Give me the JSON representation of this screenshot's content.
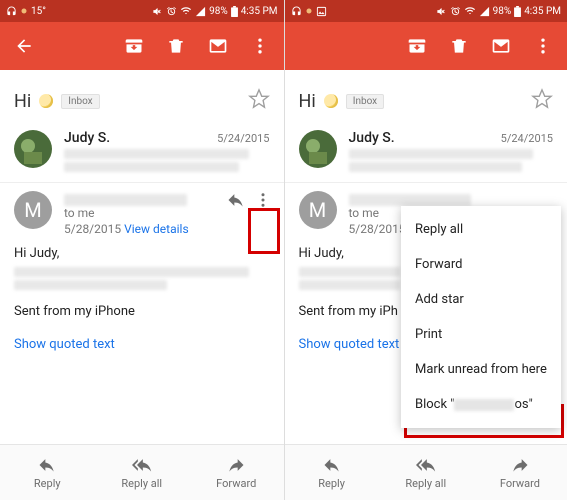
{
  "status": {
    "temp": "15°",
    "battery_pct": "98%",
    "time": "4:35 PM"
  },
  "subject": {
    "text": "Hi",
    "chip": "Inbox"
  },
  "thread1": {
    "sender": "Judy S.",
    "date": "5/24/2015"
  },
  "msg2": {
    "to": "to me",
    "date": "5/28/2015",
    "details": "View details",
    "thread_date": "5/24/2015"
  },
  "body": {
    "greeting": "Hi Judy,",
    "signature": "Sent from my iPhone",
    "signature_partial": "Sent from my iPh",
    "quoted": "Show quoted text"
  },
  "bottom": {
    "reply": "Reply",
    "reply_all": "Reply all",
    "forward": "Forward"
  },
  "popup": {
    "reply_all": "Reply all",
    "forward": "Forward",
    "add_star": "Add star",
    "print": "Print",
    "mark_unread": "Mark unread from here",
    "block_prefix": "Block \"",
    "block_suffix": "os\""
  },
  "avatar_m": "M"
}
